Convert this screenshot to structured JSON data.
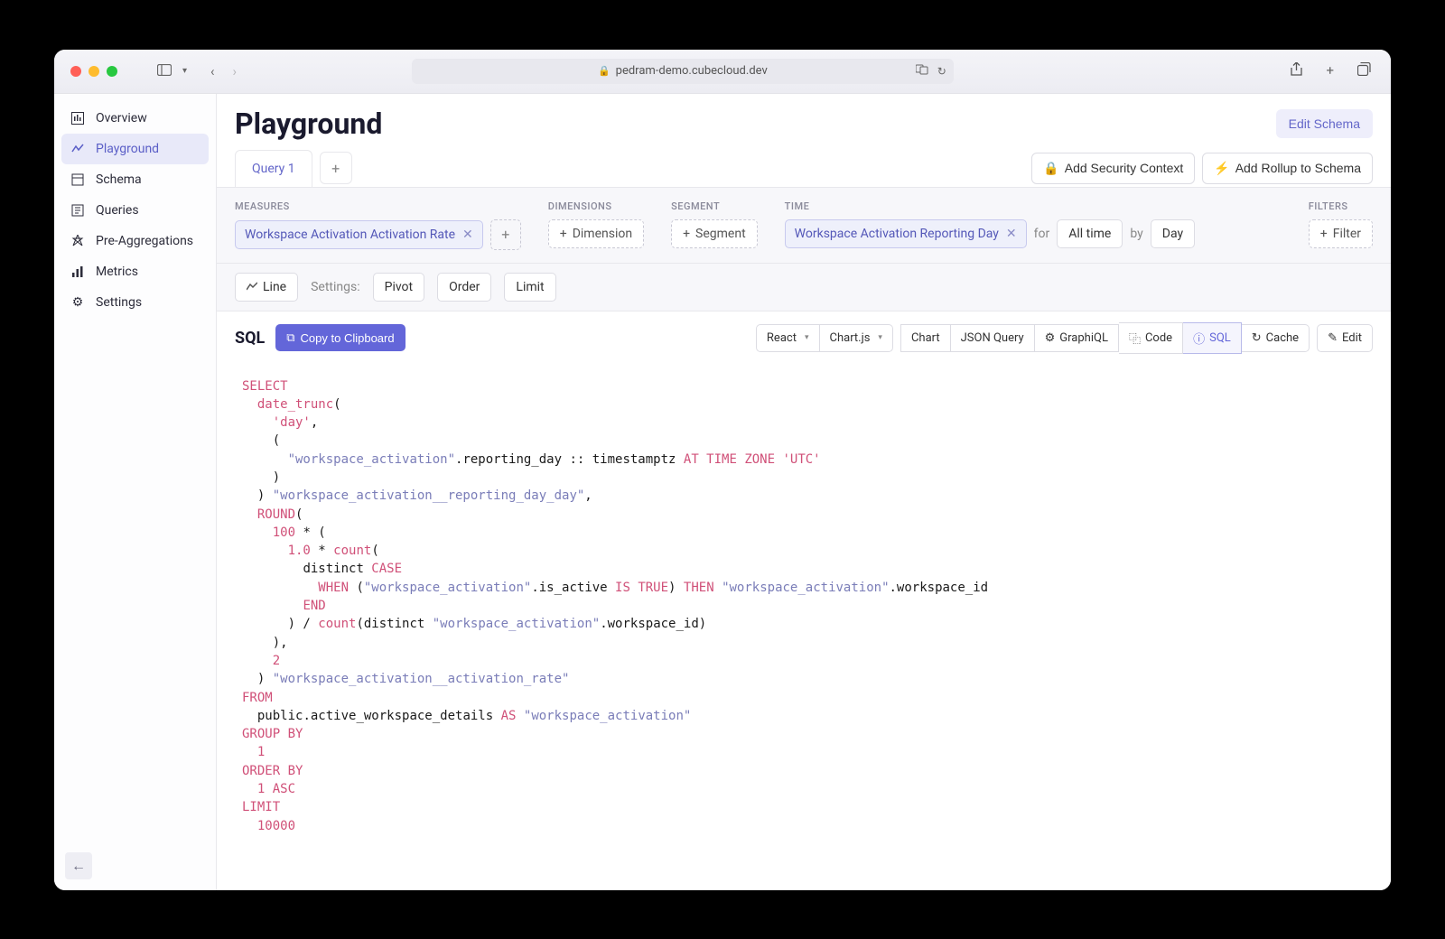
{
  "browser": {
    "url": "pedram-demo.cubecloud.dev"
  },
  "sidebar": {
    "items": [
      {
        "label": "Overview"
      },
      {
        "label": "Playground"
      },
      {
        "label": "Schema"
      },
      {
        "label": "Queries"
      },
      {
        "label": "Pre-Aggregations"
      },
      {
        "label": "Metrics"
      },
      {
        "label": "Settings"
      }
    ]
  },
  "page": {
    "title": "Playground",
    "edit_schema": "Edit Schema"
  },
  "tabs": {
    "tab1": "Query 1",
    "security": "Add Security Context",
    "rollup": "Add Rollup to Schema"
  },
  "builder": {
    "measures_label": "MEASURES",
    "measure_chip": "Workspace Activation Activation Rate",
    "dimensions_label": "DIMENSIONS",
    "dimension_btn": "Dimension",
    "segment_label": "SEGMENT",
    "segment_btn": "Segment",
    "time_label": "TIME",
    "time_chip": "Workspace Activation Reporting Day",
    "for_txt": "for",
    "alltime": "All time",
    "by_txt": "by",
    "day": "Day",
    "filters_label": "FILTERS",
    "filter_btn": "Filter"
  },
  "viz": {
    "line": "Line",
    "settings": "Settings:",
    "pivot": "Pivot",
    "order": "Order",
    "limit": "Limit"
  },
  "sql": {
    "title": "SQL",
    "copy": "Copy to Clipboard",
    "react": "React",
    "chartjs": "Chart.js",
    "chart": "Chart",
    "json": "JSON Query",
    "graphiql": "GraphiQL",
    "code": "Code",
    "sql_tab": "SQL",
    "cache": "Cache",
    "edit": "Edit"
  },
  "code": {
    "l1": "SELECT",
    "l2a": "date_trunc",
    "l2b": "(",
    "l3a": "'day'",
    "l3b": ",",
    "l4": "(",
    "l5a": "\"workspace_activation\"",
    "l5b": ".reporting_day :: timestamptz ",
    "l5c": "AT TIME ZONE 'UTC'",
    "l6": ")",
    "l7a": ") ",
    "l7b": "\"workspace_activation__reporting_day_day\"",
    "l7c": ",",
    "l8a": "ROUND",
    "l8b": "(",
    "l9a": "100",
    "l9b": " * (",
    "l10a": "1.0",
    "l10b": " * ",
    "l10c": "count",
    "l10d": "(",
    "l11a": "distinct ",
    "l11b": "CASE",
    "l12a": "WHEN",
    "l12b": " (",
    "l12c": "\"workspace_activation\"",
    "l12d": ".is_active ",
    "l12e": "IS TRUE",
    "l12f": ") ",
    "l12g": "THEN",
    "l12h": " ",
    "l12i": "\"workspace_activation\"",
    "l12j": ".workspace_id",
    "l13": "END",
    "l14a": ") / ",
    "l14b": "count",
    "l14c": "(distinct ",
    "l14d": "\"workspace_activation\"",
    "l14e": ".workspace_id)",
    "l15": "),",
    "l16": "2",
    "l17a": ") ",
    "l17b": "\"workspace_activation__activation_rate\"",
    "l18": "FROM",
    "l19a": "public",
    "l19b": ".active_workspace_details ",
    "l19c": "AS",
    "l19d": " ",
    "l19e": "\"workspace_activation\"",
    "l20": "GROUP BY",
    "l21": "1",
    "l22": "ORDER BY",
    "l23a": "1",
    "l23b": " ",
    "l23c": "ASC",
    "l24": "LIMIT",
    "l25": "10000"
  }
}
